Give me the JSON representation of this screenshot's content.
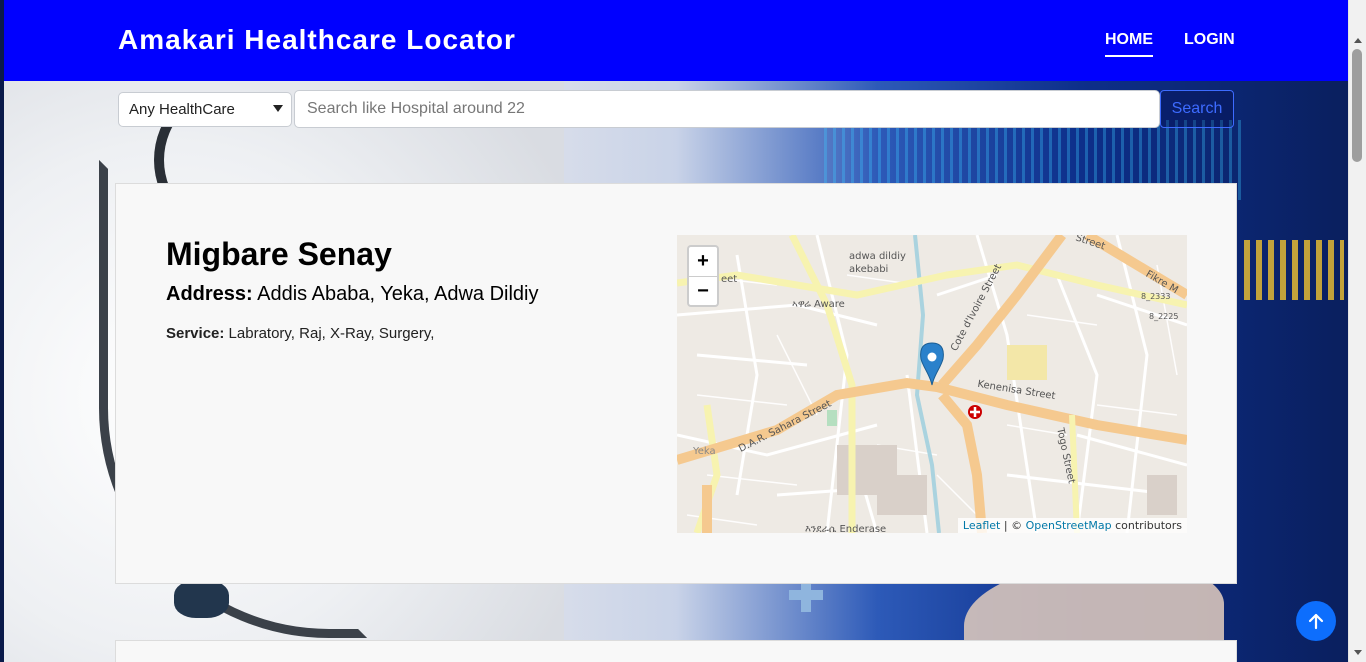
{
  "navbar": {
    "brand": "Amakari Healthcare Locator",
    "links": [
      {
        "label": "HOME",
        "active": true
      },
      {
        "label": "LOGIN",
        "active": false
      }
    ],
    "color": "#0000ff"
  },
  "search": {
    "type_selected": "Any HealthCare",
    "placeholder": "Search like Hospital around 22",
    "button_label": "Search"
  },
  "facility": {
    "name": "Migbare Senay",
    "address_label": "Address:",
    "address_value": "Addis Ababa, Yeka, Adwa Dildiy",
    "service_label": "Service:",
    "service_value": "Labratory, Raj, X-Ray, Surgery,"
  },
  "map": {
    "zoom_in": "+",
    "zoom_out": "−",
    "attribution_leaflet": "Leaflet",
    "attribution_sep": " | © ",
    "attribution_osm": "OpenStreetMap",
    "attribution_tail": " contributors",
    "labels": {
      "area1": "adwa dildiy",
      "area2": "akebabi",
      "aware": "ኣዋሬ Aware",
      "cote": "Cote d'Ivoire Street",
      "kenenisa": "Kenenisa Street",
      "sahara": "D.A.R. Sahara Street",
      "togo": "Togo Street",
      "street_top": "Street",
      "fikre": "Fikre M",
      "enderase": "እንደራሴ Enderase",
      "yeka": "Yeka",
      "num1": "8_2333",
      "num2": "8_2225",
      "edge": "eet"
    },
    "marker_icon": "map-pin-icon"
  },
  "back_to_top_icon": "arrow-up-icon"
}
